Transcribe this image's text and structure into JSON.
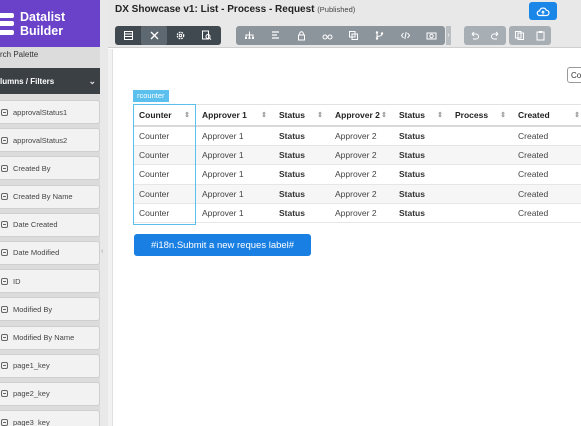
{
  "brand": {
    "line1": "Datalist",
    "line2": "Builder",
    "color": "#6a42c9"
  },
  "sidebar": {
    "search_label": "rch Palette",
    "section_title": "lumns / Filters",
    "fields": [
      {
        "label": "approvalStatus1"
      },
      {
        "label": "approvalStatus2"
      },
      {
        "label": "Created By"
      },
      {
        "label": "Created By Name"
      },
      {
        "label": "Date Created"
      },
      {
        "label": "Date Modified"
      },
      {
        "label": "ID"
      },
      {
        "label": "Modified By"
      },
      {
        "label": "Modified By Name"
      },
      {
        "label": "page1_key"
      },
      {
        "label": "page2_key"
      },
      {
        "label": "page3_key"
      }
    ]
  },
  "header": {
    "title": "DX Showcase v1: List - Process - Request",
    "status": "(Published)",
    "accent": "#1a86e8"
  },
  "toolbar": {
    "group1": [
      "list-icon",
      "tools-icon",
      "gear-icon",
      "preview-icon"
    ],
    "group2": [
      "sitemap-icon",
      "align-icon",
      "lock-icon",
      "binoculars-icon",
      "copy-icon",
      "branch-icon",
      "code-icon",
      "camera-icon"
    ],
    "group3": [
      "undo-icon",
      "redo-icon"
    ],
    "group4": [
      "duplicate-icon",
      "paste-icon"
    ]
  },
  "canvas": {
    "right_input_value": "Cou",
    "component_tag": "rcounter",
    "columns": [
      "Counter",
      "Approver 1",
      "Status",
      "Approver 2",
      "Status",
      "Process",
      "Created"
    ],
    "rows": [
      [
        "Counter",
        "Approver 1",
        "Status",
        "Approver 2",
        "Status",
        "",
        "Created"
      ],
      [
        "Counter",
        "Approver 1",
        "Status",
        "Approver 2",
        "Status",
        "",
        "Created"
      ],
      [
        "Counter",
        "Approver 1",
        "Status",
        "Approver 2",
        "Status",
        "",
        "Created"
      ],
      [
        "Counter",
        "Approver 1",
        "Status",
        "Approver 2",
        "Status",
        "",
        "Created"
      ],
      [
        "Counter",
        "Approver 1",
        "Status",
        "Approver 2",
        "Status",
        "",
        "Created"
      ]
    ],
    "submit_label": "#i18n.Submit a new reques label#"
  }
}
